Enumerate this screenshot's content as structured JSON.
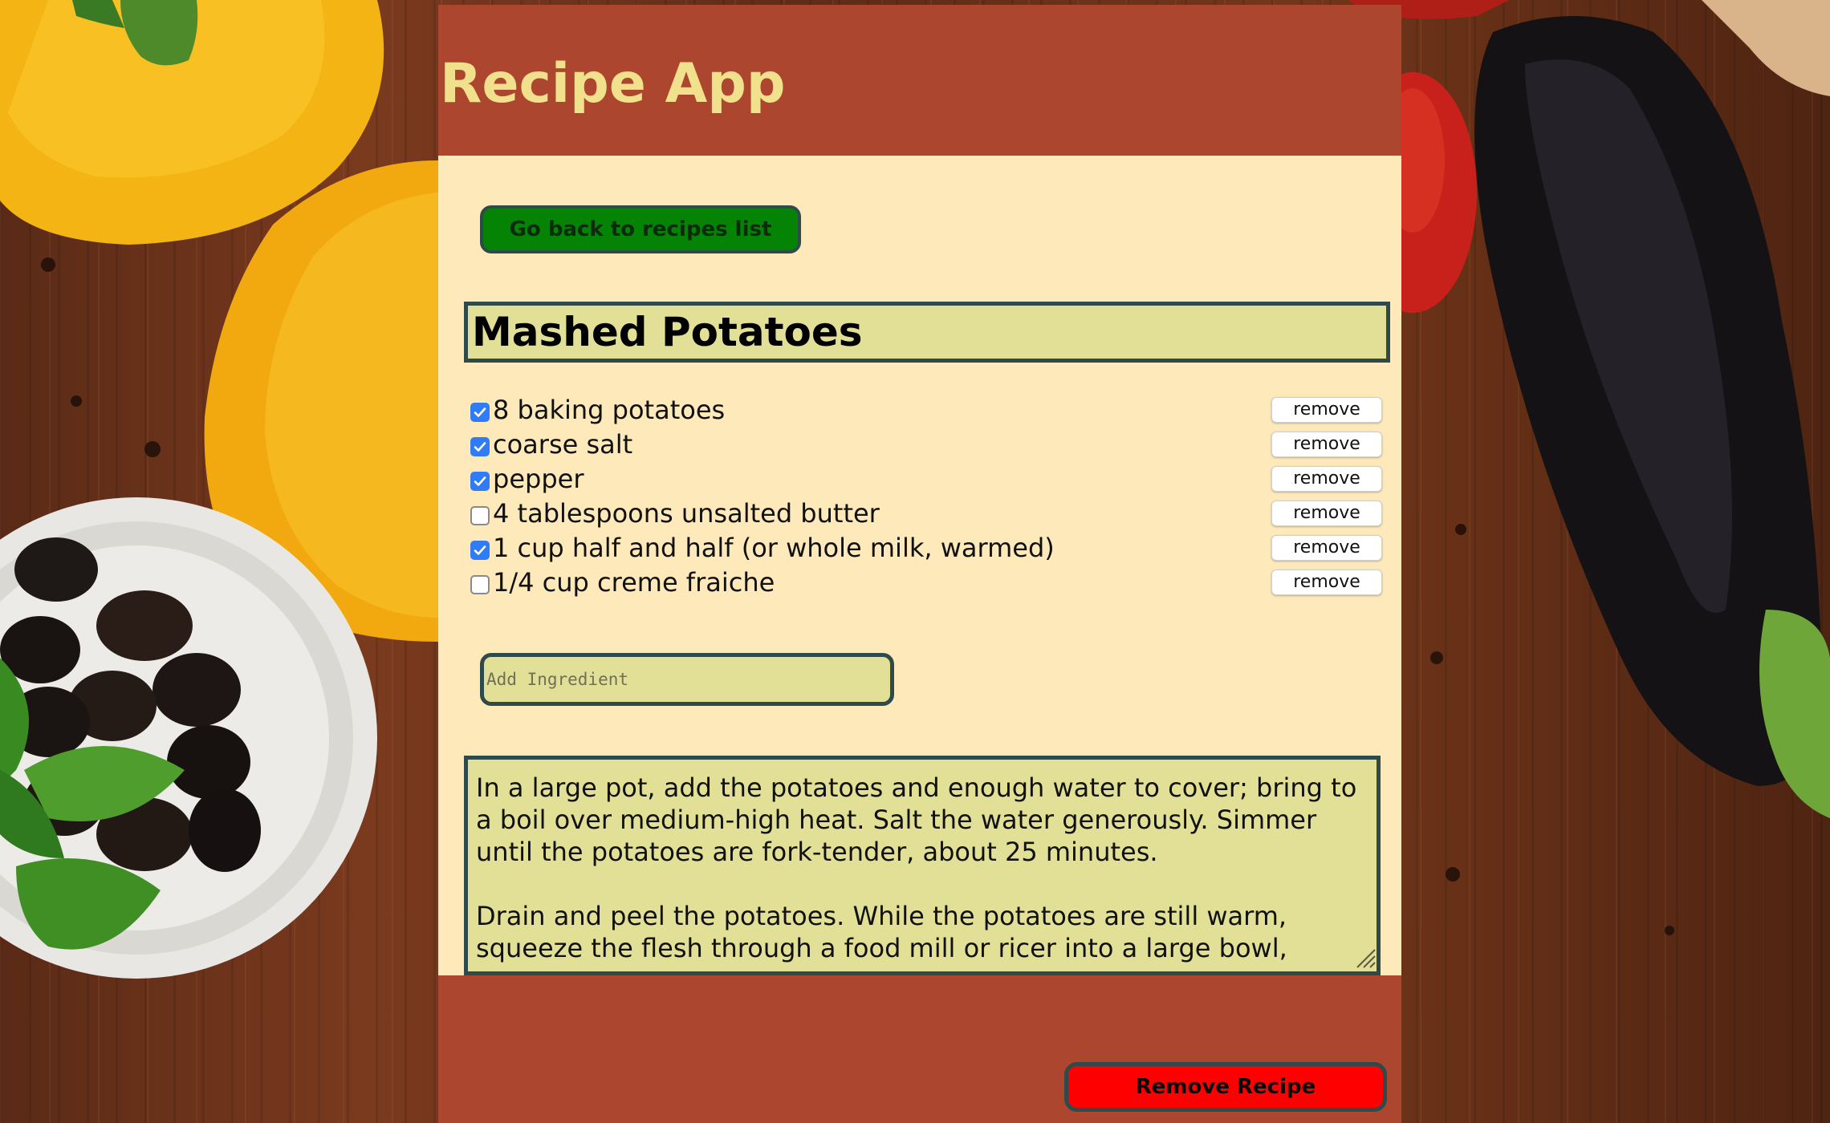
{
  "app": {
    "title": "Recipe App"
  },
  "navigation": {
    "back_label": "Go back to recipes list"
  },
  "recipe": {
    "name": "Mashed Potatoes",
    "ingredients": [
      {
        "label": "8 baking potatoes",
        "checked": true,
        "remove_label": "remove"
      },
      {
        "label": "coarse salt",
        "checked": true,
        "remove_label": "remove"
      },
      {
        "label": "pepper",
        "checked": true,
        "remove_label": "remove"
      },
      {
        "label": "4 tablespoons unsalted butter",
        "checked": false,
        "remove_label": "remove"
      },
      {
        "label": "1 cup half and half (or whole milk, warmed)",
        "checked": true,
        "remove_label": "remove"
      },
      {
        "label": "1/4 cup creme fraiche",
        "checked": false,
        "remove_label": "remove"
      }
    ],
    "add_ingredient": {
      "placeholder": "Add Ingredient",
      "value": ""
    },
    "instructions": "In a large pot, add the potatoes and enough water to cover; bring to a boil over medium-high heat. Salt the water generously. Simmer until the potatoes are fork-tender, about 25 minutes.\n\nDrain and peel the potatoes. While the potatoes are still warm, squeeze the flesh through a food mill or ricer into a large bowl,",
    "remove_recipe_label": "Remove Recipe"
  },
  "colors": {
    "header_bg": "#ad462e",
    "title_text": "#f1e08c",
    "body_bg": "#fde9ba",
    "field_bg": "#e2e096",
    "field_border": "#2f4a4a",
    "back_button_bg": "#058305",
    "remove_recipe_bg": "#ff0000",
    "checkbox_checked": "#2f7cf6"
  },
  "icons": {
    "checkbox_checked": "checkmark-icon",
    "resize": "resize-grip-icon"
  },
  "background": {
    "description_items": [
      "yellow-bell-pepper",
      "olives-bowl",
      "basil-leaves",
      "eggplant",
      "tomato",
      "wooden-table"
    ]
  }
}
